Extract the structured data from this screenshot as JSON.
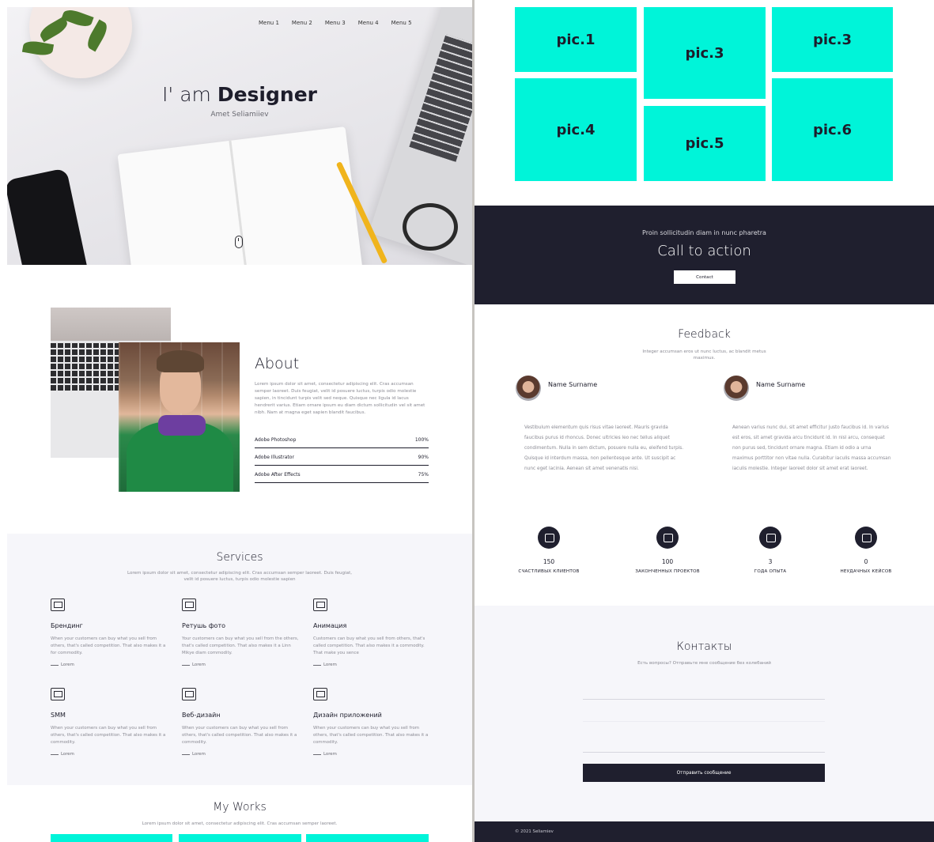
{
  "hero": {
    "nav": [
      "Menu 1",
      "Menu 2",
      "Menu 3",
      "Menu 4",
      "Menu 5"
    ],
    "title_prefix": "I' am",
    "title_bold": "Designer",
    "subtitle": "Amet Seliamiiev"
  },
  "about": {
    "title": "About",
    "text": "Lorem ipsum dolor sit amet, consectetur adipiscing elit. Cras accumsan semper laoreet. Duis feugiat, velit id posuere luctus, turpis odio molestie sapien, in tincidunt turpis velit sed neque. Quisque nec ligula id lacus hendrerit varius. Etiam ornare ipsum eu diam dictum sollicitudin vel sit amet nibh. Nam at magna eget sapien blandit faucibus.",
    "skills": [
      {
        "name": "Adobe Photoshop",
        "value": "100%"
      },
      {
        "name": "Adobe Illustrator",
        "value": "90%"
      },
      {
        "name": "Adobe After Effects",
        "value": "75%"
      }
    ]
  },
  "services": {
    "title": "Services",
    "subtitle": "Lorem ipsum dolor sit amet, consectetur adipiscing elit. Cras accumsan semper laoreet. Duis feugiat, velit id posuere luctus, turpis odio molestie sapien",
    "items": [
      {
        "title": "Брендинг",
        "icon": "presentation-icon",
        "text": "When your customers can buy what you sell from others, that's called competition. That also makes it a for commodity.",
        "link": "Lorem"
      },
      {
        "title": "Ретушь фото",
        "icon": "camera-icon",
        "text": "Your customers can buy what you sell from the others, that's called competition. That also makes it a Linn Mikye diam commodity.",
        "link": "Lorem"
      },
      {
        "title": "Анимация",
        "icon": "monitor-chart-icon",
        "text": "Customers can buy what you sell from others, that's called competition. That also makes it a commodity. That make you sence",
        "link": "Lorem"
      },
      {
        "title": "SMM",
        "icon": "network-icon",
        "text": "When your customers can buy what you sell from others, that's called competition. That also makes it a commodity.",
        "link": "Lorem"
      },
      {
        "title": "Веб-дизайн",
        "icon": "web-layout-icon",
        "text": "When your customers can buy what you sell from others, that's called competition. That also makes it a commodity.",
        "link": "Lorem"
      },
      {
        "title": "Дизайн приложений",
        "icon": "app-design-icon",
        "text": "When your customers can buy what you sell from others, that's called competition. That also makes it a commodity.",
        "link": "Lorem"
      }
    ]
  },
  "works": {
    "title": "My Works",
    "subtitle": "Lorem ipsum dolor sit amet, consectetur adipiscing elit. Cras accumsan semper laoreet.",
    "pics": [
      "pic.1",
      "pic.3",
      "pic.3",
      "pic.4",
      "pic.5",
      "pic.6"
    ],
    "tile_color": "#00f4d9"
  },
  "cta": {
    "subtitle": "Proin sollicitudin diam in nunc pharetra",
    "title": "Call to action",
    "button": "Contact"
  },
  "feedback": {
    "title": "Feedback",
    "subtitle": "Integer accumsan eros ut nunc luctus, ac blandit metus maximus.",
    "reviews": [
      {
        "name": "Name Surname",
        "text": "Vestibulum elementum quis risus vitae laoreet. Mauris gravida faucibus purus id rhoncus. Donec ultricies leo nec tellus aliquet condimentum. Nulla in sem dictum, posuere nulla eu, eleifend turpis. Quisque id interdum massa, non pellentesque ante. Ut suscipit ac nunc eget lacinia. Aenean sit amet venenatis nisi."
      },
      {
        "name": "Name Surname",
        "text": "Aenean varius nunc dui, sit amet efficitur justo faucibus id. In varius est eros, sit amet gravida arcu tincidunt id. In nisl arcu, consequat non purus sed, tincidunt ornare magna. Etiam id odio a urna maximus porttitor non vitae nulla. Curabitur iaculis massa accumsan iaculis molestie. Integer laoreet dolor sit amet erat laoreet."
      }
    ]
  },
  "stats": [
    {
      "value": "150",
      "label": "СЧАСТЛИВЫХ КЛИЕНТОВ"
    },
    {
      "value": "100",
      "label": "ЗАКОНЧЕННЫХ ПРОЕКТОВ"
    },
    {
      "value": "3",
      "label": "ГОДА ОПЫТА"
    },
    {
      "value": "0",
      "label": "НЕУДАЧНЫХ КЕЙСОВ"
    }
  ],
  "contacts": {
    "title": "Контакты",
    "subtitle": "Есть вопросы? Отправьте мне сообщение без колебаний",
    "button": "Отправить сообщение"
  },
  "footer": {
    "text": "© 2021 Seliamiev"
  },
  "colors": {
    "dark": "#1f1f2e",
    "accent": "#00f4d9",
    "muted": "#8a8a93",
    "section_bg": "#f6f6fa"
  }
}
